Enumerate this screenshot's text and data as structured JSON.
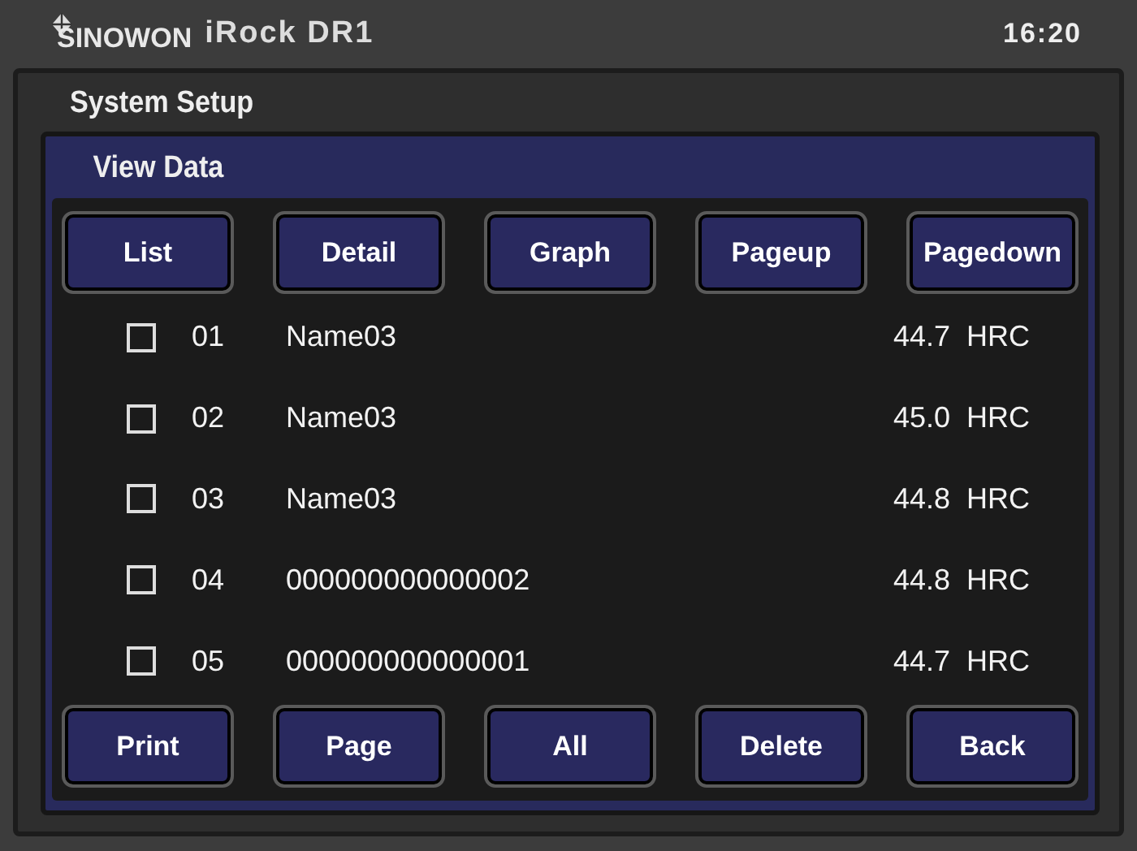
{
  "header": {
    "brand": "SINOWON",
    "model": "iRock DR1",
    "time": "16:20"
  },
  "screen_title": "System Setup",
  "panel_title": "View Data",
  "top_buttons": [
    "List",
    "Detail",
    "Graph",
    "Pageup",
    "Pagedown"
  ],
  "rows": [
    {
      "checked": false,
      "index": "01",
      "name": "Name03",
      "value": "44.7  HRC"
    },
    {
      "checked": false,
      "index": "02",
      "name": "Name03",
      "value": "45.0  HRC"
    },
    {
      "checked": false,
      "index": "03",
      "name": "Name03",
      "value": "44.8  HRC"
    },
    {
      "checked": false,
      "index": "04",
      "name": "000000000000002",
      "value": "44.8  HRC"
    },
    {
      "checked": false,
      "index": "05",
      "name": "000000000000001",
      "value": "44.7  HRC"
    }
  ],
  "bottom_buttons": [
    "Print",
    "Page",
    "All",
    "Delete",
    "Back"
  ]
}
